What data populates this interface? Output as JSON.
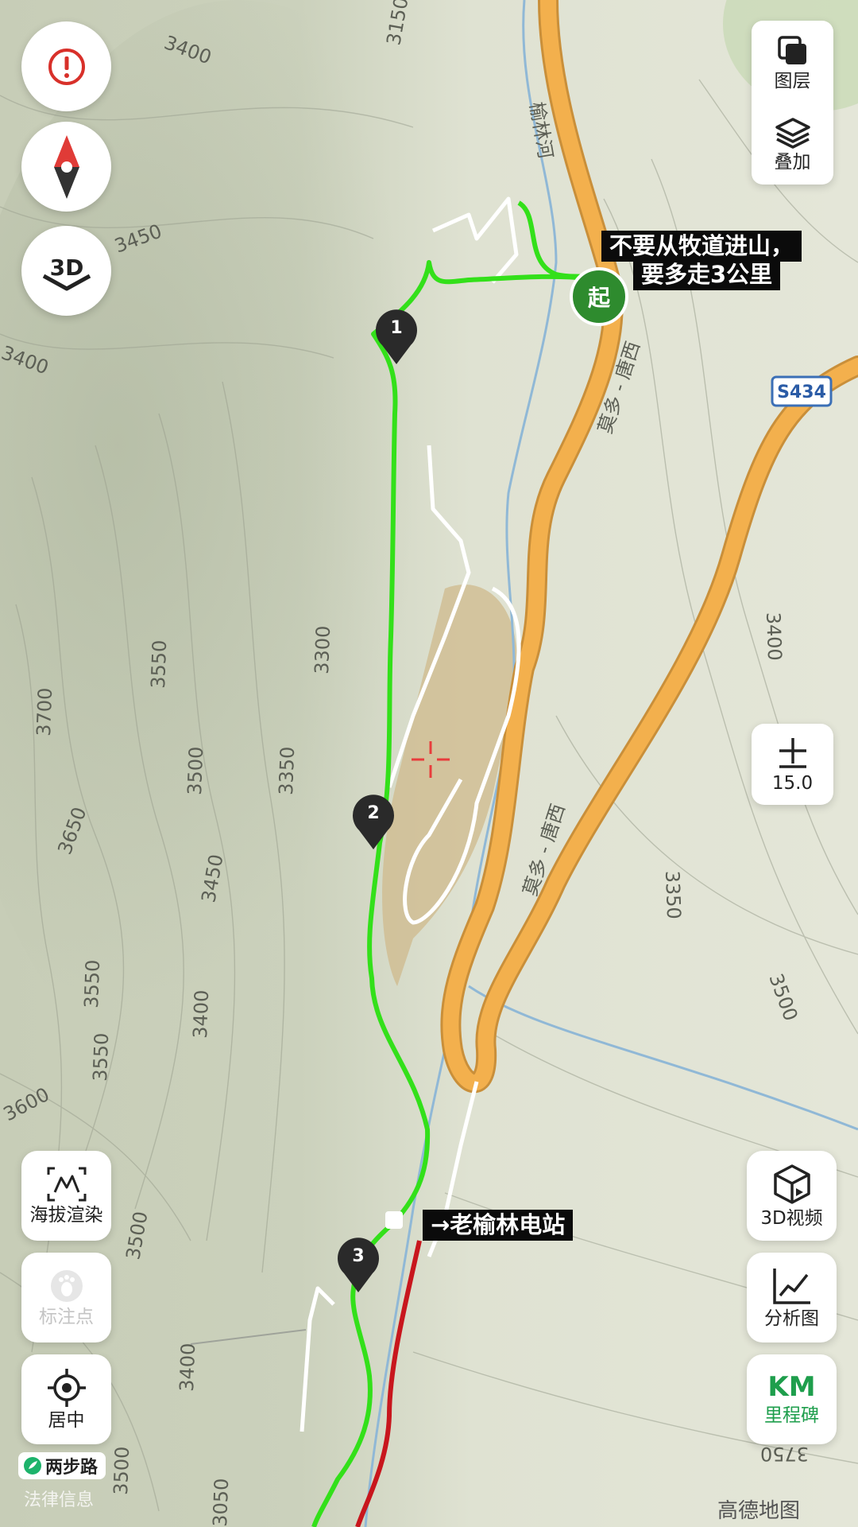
{
  "map": {
    "contour_labels": [
      "3150",
      "3400",
      "3450",
      "3400",
      "3550",
      "3300",
      "3700",
      "3500",
      "3350",
      "3650",
      "3450",
      "3550",
      "3550",
      "3400",
      "3600",
      "3500",
      "3400",
      "3500",
      "3400",
      "3350",
      "3500",
      "3750",
      "3050"
    ],
    "river_label": "榆林河",
    "road_label_upper": "莫多 - 唐西",
    "road_label_lower": "莫多 - 唐西",
    "highway_badge": "S434",
    "start_marker": "起",
    "waypoints": [
      "1",
      "2",
      "3"
    ],
    "annotation_top": [
      "不要从牧道进山，",
      "要多走3公里"
    ],
    "annotation_bottom": "→老榆林电站",
    "route_color": "#33e01a",
    "road_color": "#f3b04d",
    "red_route_color": "#c8161d"
  },
  "left_controls": {
    "alert_icon": "alert-circle-icon",
    "compass_icon": "compass-icon",
    "threed_label": "3D",
    "elevation_label": "海拔渲染",
    "mark_label": "标注点",
    "center_label": "居中"
  },
  "right_controls": {
    "layers_label": "图层",
    "overlay_label": "叠加",
    "zoom_level": "15.0",
    "video3d_label": "3D视频",
    "analysis_label": "分析图",
    "km_label": "KM",
    "milestone_label": "里程碑"
  },
  "footer": {
    "brand": "两步路",
    "legal": "法律信息",
    "provider": "高德地图"
  }
}
